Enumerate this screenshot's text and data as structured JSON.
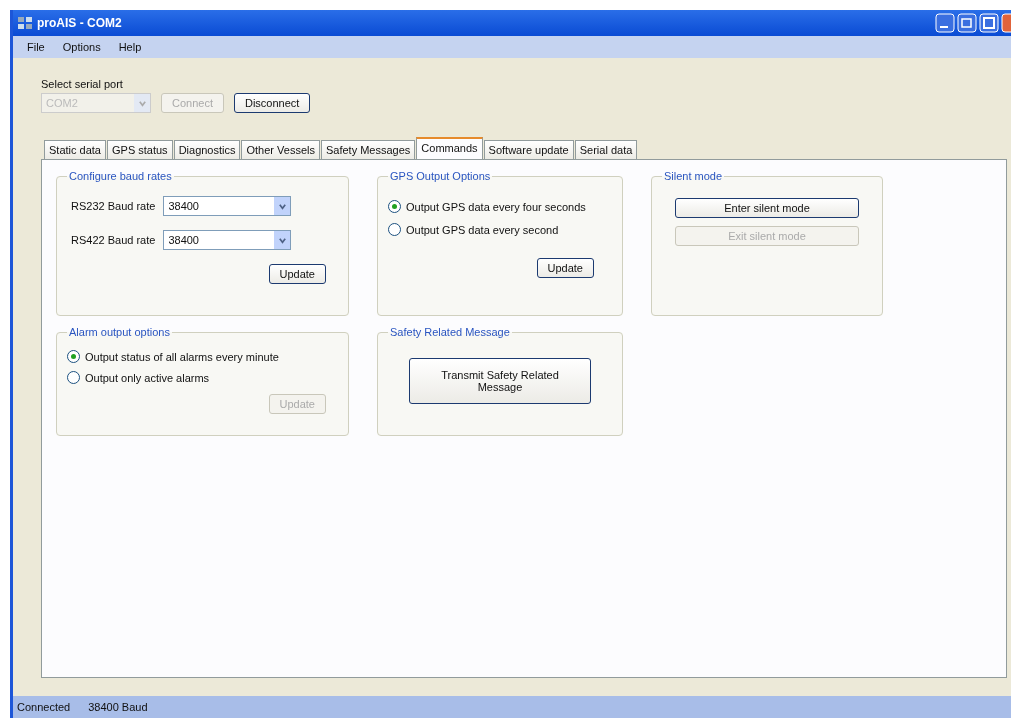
{
  "window": {
    "title": "proAIS - COM2"
  },
  "menu": [
    {
      "label": "File"
    },
    {
      "label": "Options"
    },
    {
      "label": "Help"
    }
  ],
  "serial_port": {
    "label": "Select serial port",
    "value": "COM2",
    "disabled": true,
    "buttons": [
      {
        "label": "Connect",
        "disabled": true
      },
      {
        "label": "Disconnect",
        "disabled": false
      }
    ]
  },
  "tabs": [
    {
      "label": "Static data",
      "selected": false
    },
    {
      "label": "GPS status",
      "selected": false
    },
    {
      "label": "Diagnostics",
      "selected": false
    },
    {
      "label": "Other Vessels",
      "selected": false
    },
    {
      "label": "Safety Messages",
      "selected": false
    },
    {
      "label": "Commands",
      "selected": true
    },
    {
      "label": "Software update",
      "selected": false
    },
    {
      "label": "Serial data",
      "selected": false
    }
  ],
  "baud_rates": {
    "title": "Configure baud rates",
    "fields": [
      {
        "label": "RS232 Baud rate",
        "value": "38400"
      },
      {
        "label": "RS422 Baud rate",
        "value": "38400"
      }
    ],
    "button": {
      "label": "Update",
      "disabled": false
    }
  },
  "gps_output": {
    "title": "GPS Output Options",
    "options": [
      {
        "label": "Output GPS data every four seconds",
        "selected": true
      },
      {
        "label": "Output GPS data every second",
        "selected": false
      }
    ],
    "button": {
      "label": "Update",
      "disabled": false
    }
  },
  "silent_mode": {
    "title": "Silent mode",
    "buttons": [
      {
        "label": "Enter silent mode",
        "disabled": false
      },
      {
        "label": "Exit silent mode",
        "disabled": true
      }
    ]
  },
  "alarm_output": {
    "title": "Alarm output options",
    "options": [
      {
        "label": "Output status of all alarms every minute",
        "selected": true
      },
      {
        "label": "Output only active alarms",
        "selected": false
      }
    ],
    "button": {
      "label": "Update",
      "disabled": true
    }
  },
  "safety_message": {
    "title": "Safety Related Message",
    "button": {
      "label": "Transmit Safety Related Message",
      "disabled": false
    }
  },
  "status_bar": [
    "Connected",
    "38400 Baud"
  ]
}
